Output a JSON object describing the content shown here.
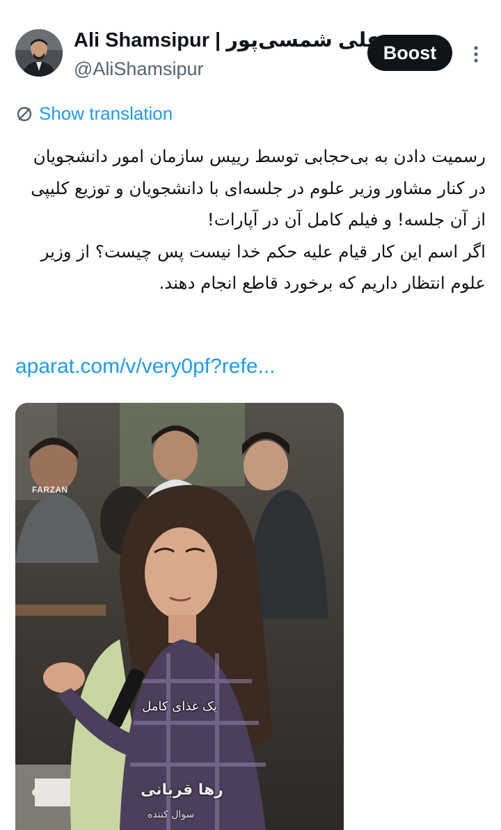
{
  "post": {
    "author": {
      "display_name": "Ali Shamsipur | علی شمسی‌پور",
      "handle": "@AliShamsipur"
    },
    "boost_label": "Boost",
    "translate_icon": "no-translate-icon",
    "show_translation_label": "Show translation",
    "text_paragraphs": [
      "رسمیت دادن به بی‌حجابی توسط رییس سازمان امور دانشجویان در کنار مشاور وزیر علوم در جلسه‌ای با دانشجویان و توزیع کلیپی از آن جلسه! و فیلم کامل آن در آپارات!",
      "اگر اسم این کار قیام علیه حکم خدا نیست پس چیست؟ از وزیر علوم انتظار داریم که برخورد قاطع انجام دهند."
    ],
    "link_text": "aparat.com/v/very0pf?refe...",
    "media": {
      "watermark_logo": "FARZAN",
      "caption_main": "یک غذای کامل",
      "caption_name": "رها قربانی",
      "caption_sub": "سوال کننده"
    }
  },
  "colors": {
    "accent": "#1d9bf0",
    "text": "#0f1419",
    "secondary": "#536471",
    "button_bg": "#0f1419"
  }
}
